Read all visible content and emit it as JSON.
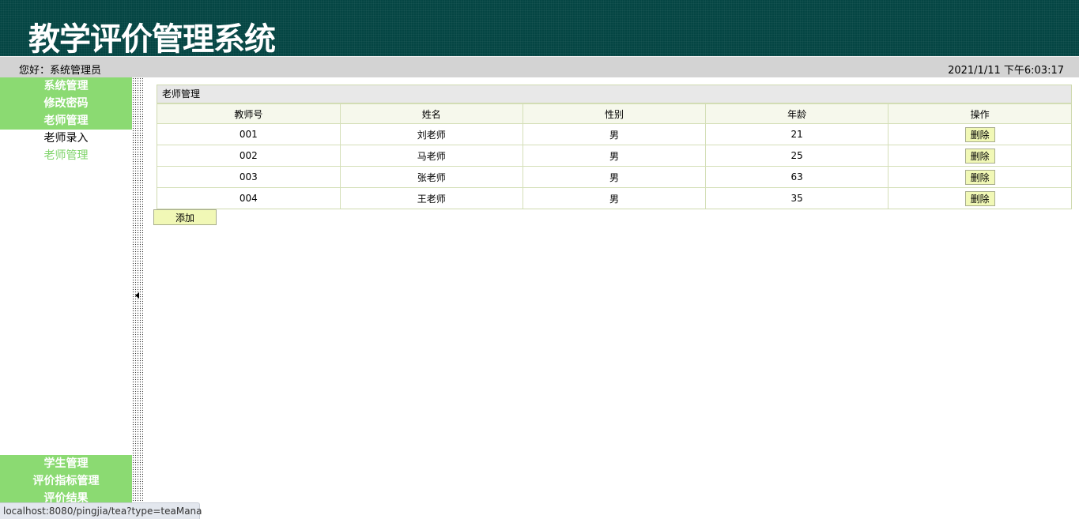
{
  "header": {
    "title": "教学评价管理系统"
  },
  "infobar": {
    "greeting": "您好：",
    "user": "系统管理员",
    "datetime": "2021/1/11 下午6:03:17"
  },
  "sidebar": {
    "top_groups": [
      {
        "label": "系统管理"
      },
      {
        "label": "修改密码"
      },
      {
        "label": "老师管理",
        "items": [
          "老师录入",
          "老师管理"
        ]
      }
    ],
    "bottom_groups": [
      {
        "label": "学生管理"
      },
      {
        "label": "评价指标管理"
      },
      {
        "label": "评价结果"
      }
    ]
  },
  "panel": {
    "title": "老师管理",
    "columns": [
      "教师号",
      "姓名",
      "性别",
      "年龄",
      "操作"
    ],
    "rows": [
      {
        "id": "001",
        "name": "刘老师",
        "gender": "男",
        "age": "21"
      },
      {
        "id": "002",
        "name": "马老师",
        "gender": "男",
        "age": "25"
      },
      {
        "id": "003",
        "name": "张老师",
        "gender": "男",
        "age": "63"
      },
      {
        "id": "004",
        "name": "王老师",
        "gender": "男",
        "age": "35"
      }
    ],
    "delete_label": "删除"
  },
  "add_label": "添加",
  "status_url": "localhost:8080/pingjia/tea?type=teaMana"
}
